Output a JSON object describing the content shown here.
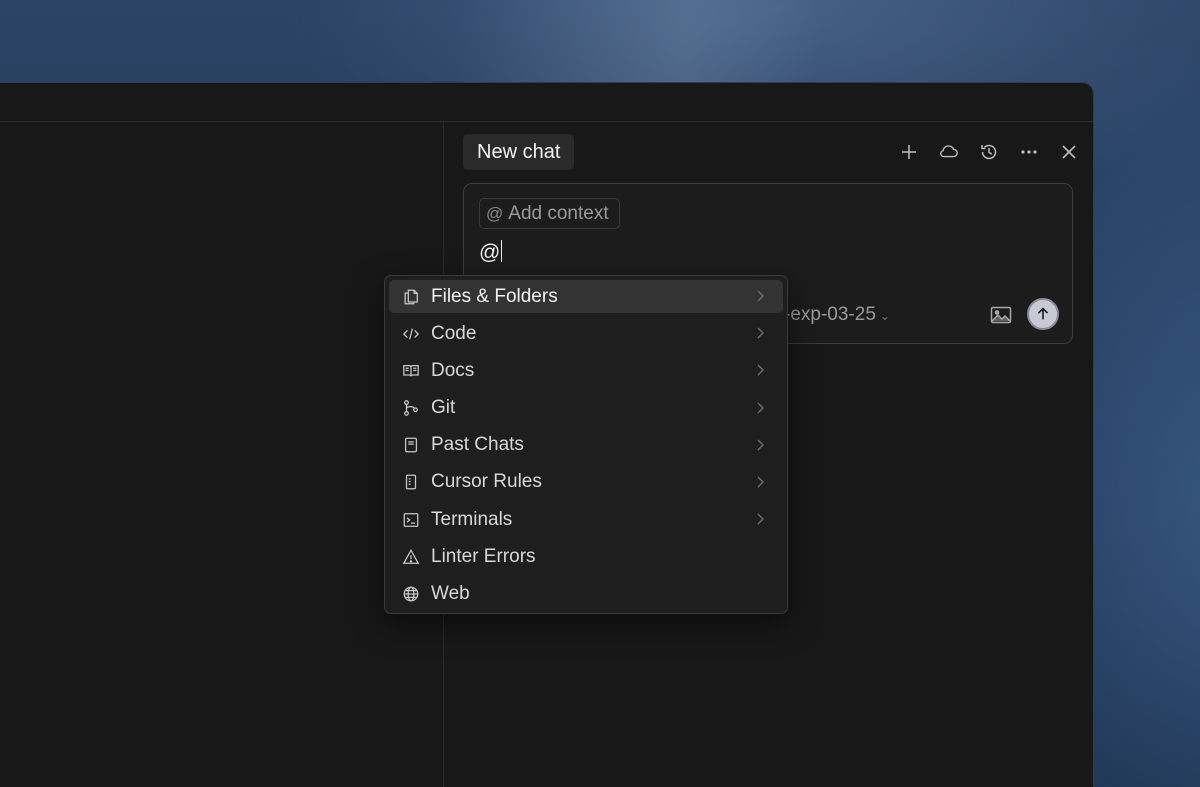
{
  "chat": {
    "title": "New chat",
    "header_icons": [
      "plus-icon",
      "cloud-icon",
      "history-icon",
      "more-icon",
      "close-icon"
    ]
  },
  "composer": {
    "context_button_prefix": "@",
    "context_button_label": "Add context",
    "input_text": "@",
    "model_label": "-exp-03-25"
  },
  "mention_menu": {
    "items": [
      {
        "label": "Files & Folders",
        "icon": "files-icon",
        "has_submenu": true,
        "active": true
      },
      {
        "label": "Code",
        "icon": "code-icon",
        "has_submenu": true
      },
      {
        "label": "Docs",
        "icon": "book-icon",
        "has_submenu": true
      },
      {
        "label": "Git",
        "icon": "git-branch-icon",
        "has_submenu": true
      },
      {
        "label": "Past Chats",
        "icon": "notebook-icon",
        "has_submenu": true
      },
      {
        "label": "Cursor Rules",
        "icon": "rules-file-icon",
        "has_submenu": true
      },
      {
        "label": "Terminals",
        "icon": "terminal-icon",
        "has_submenu": true
      },
      {
        "label": "Linter Errors",
        "icon": "warning-icon",
        "has_submenu": false
      },
      {
        "label": "Web",
        "icon": "globe-icon",
        "has_submenu": false
      }
    ]
  },
  "colors": {
    "window_bg": "#181818",
    "menu_bg": "#1e1e1e",
    "menu_active_bg": "#333333",
    "send_button_bg": "#c9c9d6"
  }
}
